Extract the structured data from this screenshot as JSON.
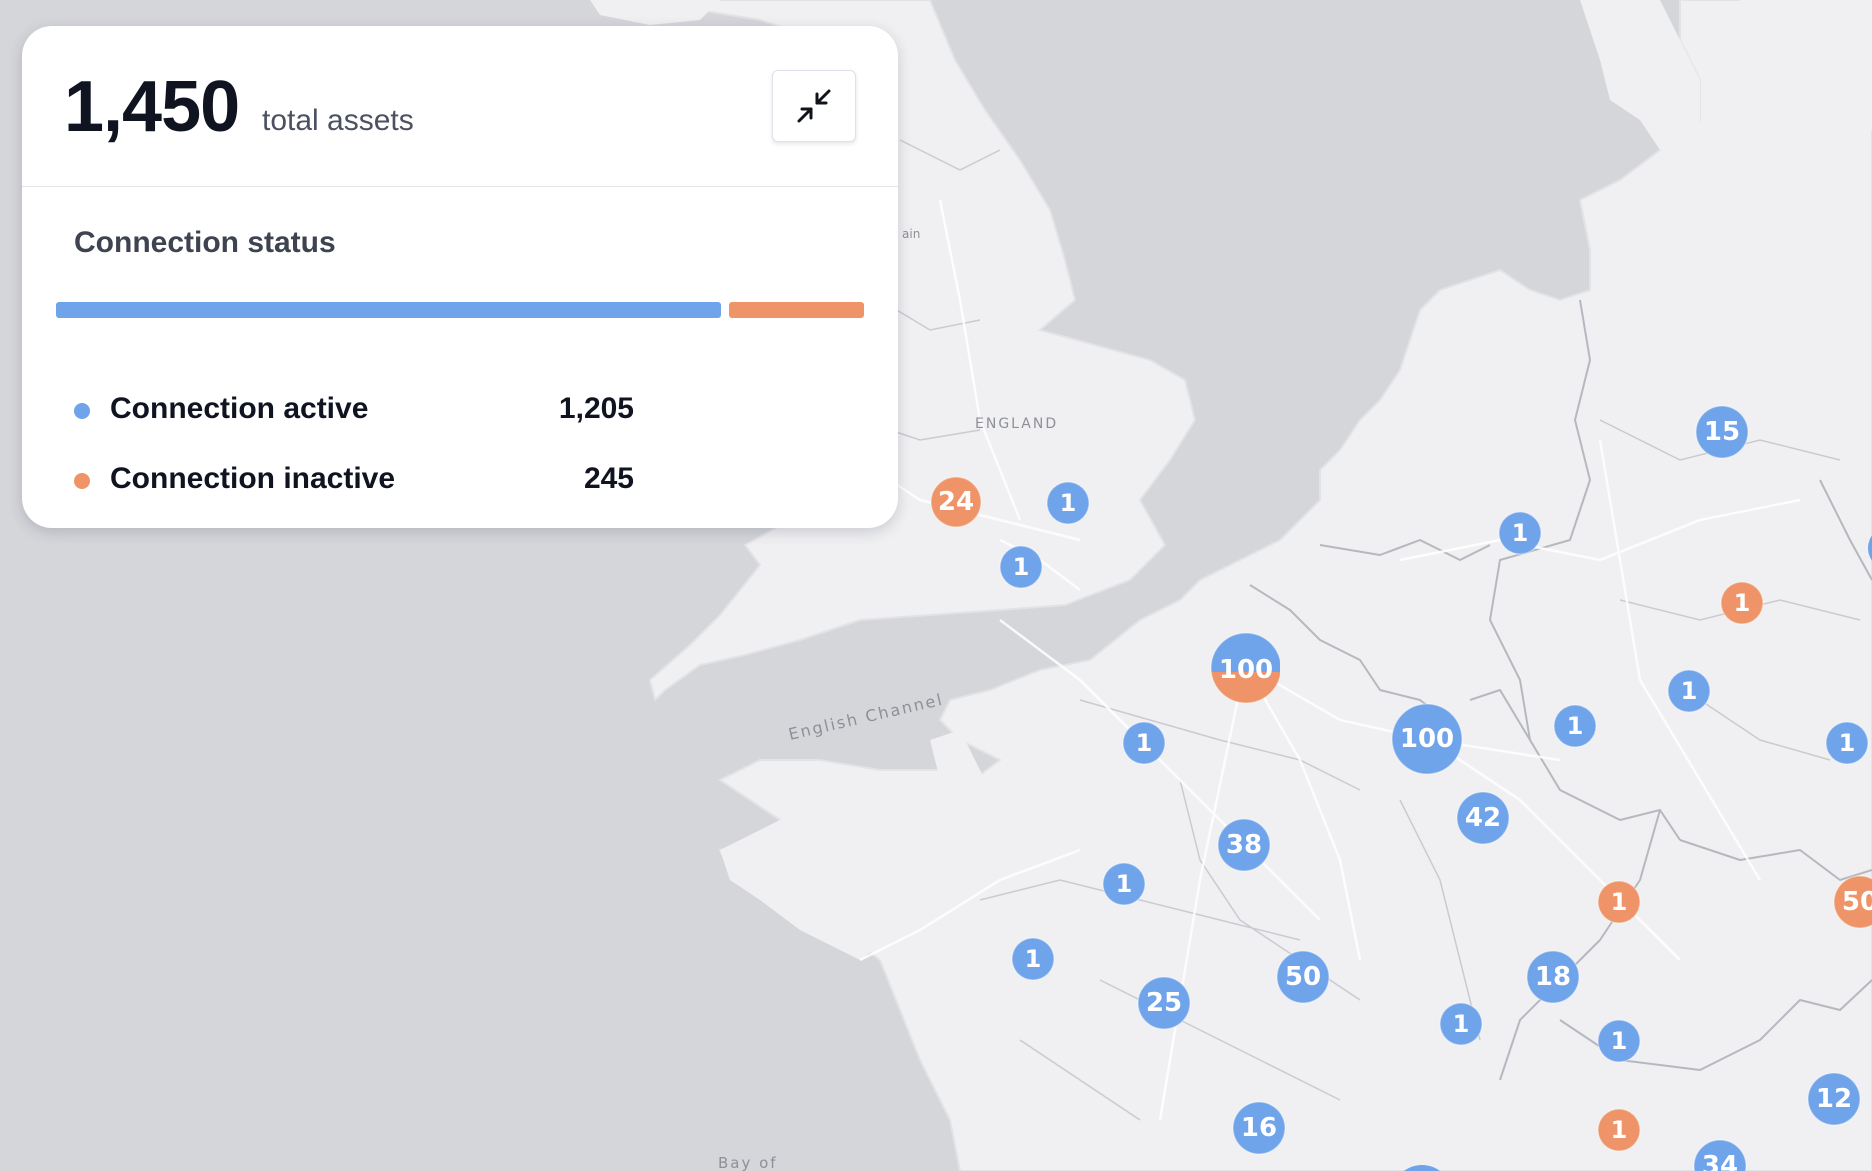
{
  "summary": {
    "total_value": "1,450",
    "total_label": "total assets",
    "collapse_icon": "minimize-arrows-icon",
    "section_title": "Connection status",
    "status_bar": {
      "active_fraction": 0.831,
      "inactive_fraction": 0.169,
      "active_color": "#6fa3ea",
      "inactive_color": "#ee9468"
    },
    "legend": [
      {
        "label": "Connection active",
        "value": "1,205",
        "color": "#6fa3ea"
      },
      {
        "label": "Connection inactive",
        "value": "245",
        "color": "#ee9468"
      }
    ]
  },
  "map": {
    "labels": {
      "england": "ENGLAND",
      "english_channel": "English Channel",
      "britain_fragment": "ain",
      "bay_fragment": "Bay of"
    },
    "colors": {
      "active": "#6fa3ea",
      "inactive": "#ee9468",
      "land": "#f0f0f2",
      "water": "#d5d6da",
      "border": "#b8bbc2"
    },
    "clusters": [
      {
        "count": "24",
        "status": "inactive"
      },
      {
        "count": "1",
        "status": "active"
      },
      {
        "count": "1",
        "status": "active"
      },
      {
        "count": "100",
        "status": "mixed"
      },
      {
        "count": "1",
        "status": "active"
      },
      {
        "count": "100",
        "status": "active"
      },
      {
        "count": "42",
        "status": "active"
      },
      {
        "count": "38",
        "status": "active"
      },
      {
        "count": "1",
        "status": "active"
      },
      {
        "count": "1",
        "status": "active"
      },
      {
        "count": "25",
        "status": "active"
      },
      {
        "count": "50",
        "status": "active"
      },
      {
        "count": "1",
        "status": "active"
      },
      {
        "count": "18",
        "status": "active"
      },
      {
        "count": "16",
        "status": "active"
      },
      {
        "count": "1",
        "status": "inactive"
      },
      {
        "count": "1",
        "status": "active"
      },
      {
        "count": "1",
        "status": "inactive"
      },
      {
        "count": "1",
        "status": "active"
      },
      {
        "count": "15",
        "status": "active"
      },
      {
        "count": "1",
        "status": "inactive"
      },
      {
        "count": "1",
        "status": "active"
      },
      {
        "count": "1",
        "status": "active"
      },
      {
        "count": "1",
        "status": "active"
      },
      {
        "count": "50",
        "status": "inactive"
      },
      {
        "count": "12",
        "status": "active"
      },
      {
        "count": "34",
        "status": "active"
      }
    ]
  }
}
